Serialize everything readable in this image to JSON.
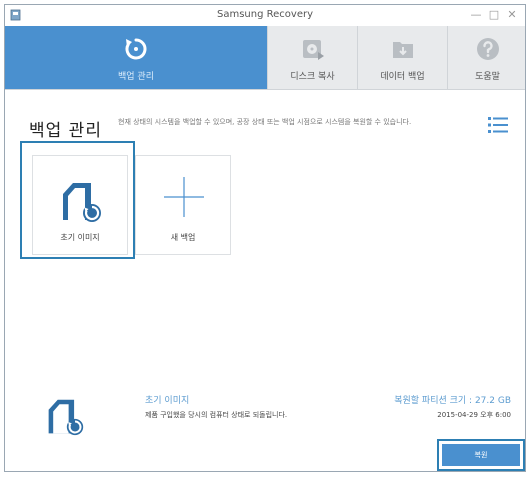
{
  "window": {
    "title": "Samsung Recovery",
    "min": "—",
    "max": "□",
    "close": "✕"
  },
  "nav": {
    "tabs": [
      {
        "label": "백업 관리",
        "icon": "restore-icon",
        "active": true
      },
      {
        "label": "디스크 복사",
        "icon": "disk-copy-icon",
        "active": false
      },
      {
        "label": "데이터 백업",
        "icon": "data-backup-icon",
        "active": false
      },
      {
        "label": "도움말",
        "icon": "help-icon",
        "active": false
      }
    ]
  },
  "header": {
    "title": "백업 관리",
    "description": "현재 상태의 시스템을 백업할 수 있으며, 공장 상태 또는 백업 시점으로 시스템을 복원할 수 있습니다."
  },
  "cards": [
    {
      "label": "초기 이미지",
      "icon": "factory-image-icon",
      "selected": true
    },
    {
      "label": "새 백업",
      "icon": "plus-icon",
      "selected": false
    }
  ],
  "details": {
    "title": "초기 이미지",
    "description": "제품 구입했을 당시의 컴퓨터 상태로 되돌립니다.",
    "size": "복원할 파티션 크기 : 27.2 GB",
    "date": "2015-04-29 오후 6:00"
  },
  "restore_button": "복원",
  "colors": {
    "accent": "#4a90cf",
    "highlight": "#2d7fb3",
    "info_text": "#5d9cd0"
  }
}
